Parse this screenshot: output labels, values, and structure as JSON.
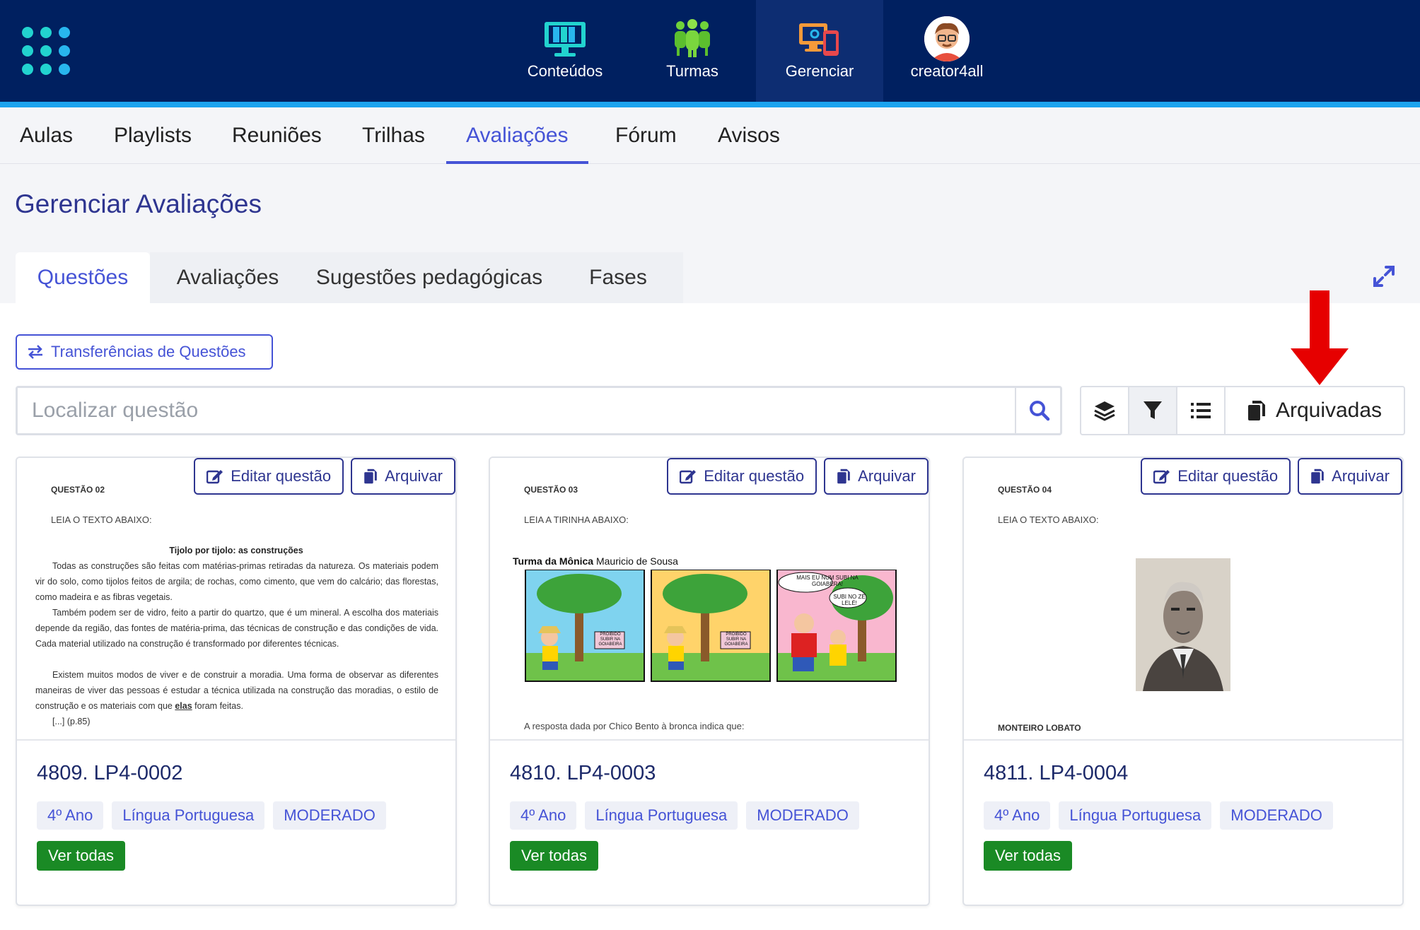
{
  "colors": {
    "header_bg": "#002060",
    "accent": "#4553d6",
    "stripe": "#1aa3ef",
    "success": "#1a8a25",
    "arrow": "#e00000"
  },
  "topnav": {
    "items": [
      {
        "label": "Conteúdos",
        "icon": "monitor-books-icon"
      },
      {
        "label": "Turmas",
        "icon": "people-group-icon"
      },
      {
        "label": "Gerenciar",
        "icon": "devices-settings-icon"
      },
      {
        "label": "creator4all",
        "icon": "avatar"
      }
    ]
  },
  "subnav": {
    "items": [
      "Aulas",
      "Playlists",
      "Reuniões",
      "Trilhas",
      "Avaliações",
      "Fórum",
      "Avisos"
    ],
    "active": "Avaliações"
  },
  "page": {
    "title": "Gerenciar Avaliações"
  },
  "tabs": {
    "items": [
      "Questões",
      "Avaliações",
      "Sugestões pedagógicas",
      "Fases"
    ],
    "active": "Questões"
  },
  "toolbar": {
    "transfer_label": "Transferências de Questões",
    "search_placeholder": "Localizar questão",
    "archived_label": "Arquivadas"
  },
  "cards": [
    {
      "code": "4809. LP4-0002",
      "edit_label": "Editar questão",
      "archive_label": "Arquivar",
      "tags": [
        "4º Ano",
        "Língua Portuguesa",
        "MODERADO"
      ],
      "view_all": "Ver todas",
      "preview": {
        "qnum": "QUESTÃO 02",
        "instruction": "LEIA O TEXTO ABAIXO:",
        "title": "Tijolo por tijolo: as construções",
        "p1": "Todas as construções são feitas com matérias-primas retiradas da natureza. Os materiais podem vir do solo, como tijolos feitos de argila; de rochas, como cimento, que vem do calcário; das florestas, como madeira e as fibras vegetais.",
        "p2": "Também podem ser de vidro, feito a partir do quartzo, que é um mineral. A escolha dos materiais depende da região, das fontes de matéria-prima, das técnicas de construção e das condições de vida. Cada material utilizado na construção é transformado por diferentes técnicas.",
        "p3a": "Existem muitos modos de viver e de construir a moradia. Uma forma de observar as diferentes maneiras de viver das pessoas é estudar a técnica utilizada na construção das moradias, o estilo de construção e os materiais com que ",
        "p3b": "elas",
        "p3c": " foram feitas.",
        "ref": "[...] (p.85)"
      }
    },
    {
      "code": "4810. LP4-0003",
      "edit_label": "Editar questão",
      "archive_label": "Arquivar",
      "tags": [
        "4º Ano",
        "Língua Portuguesa",
        "MODERADO"
      ],
      "view_all": "Ver todas",
      "preview": {
        "qnum": "QUESTÃO 03",
        "instruction": "LEIA A TIRINHA ABAIXO:",
        "comic_title_bold": "Turma da Mônica",
        "comic_author": " Mauricio de Sousa",
        "sign_text": "PROIBIDO SUBIR NA GOIABEIRA",
        "balloon1": "MAIS EU NUM SUBI NA GOIABERA!",
        "balloon2": "SUBI NO ZÉ LELÉ!",
        "question": "A resposta dada por Chico Bento à bronca indica que:"
      }
    },
    {
      "code": "4811. LP4-0004",
      "edit_label": "Editar questão",
      "archive_label": "Arquivar",
      "tags": [
        "4º Ano",
        "Língua Portuguesa",
        "MODERADO"
      ],
      "view_all": "Ver todas",
      "preview": {
        "qnum": "QUESTÃO 04",
        "instruction": "LEIA O TEXTO ABAIXO:",
        "caption": "MONTEIRO LOBATO"
      }
    }
  ]
}
